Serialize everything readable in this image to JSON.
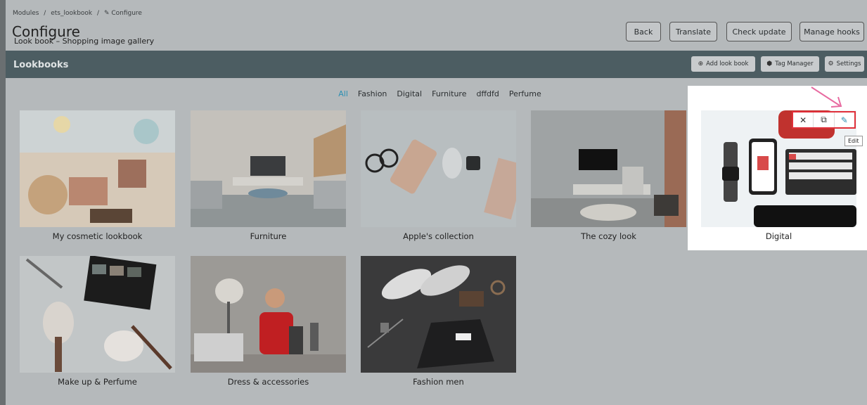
{
  "breadcrumb": [
    "Modules",
    "/",
    "ets_lookbook",
    "/",
    "✎ Configure"
  ],
  "page": {
    "title": "Configure",
    "subtitle": "Look book – Shopping image gallery"
  },
  "toolbar": {
    "back": "Back",
    "translate": "Translate",
    "check_update": "Check update",
    "manage_hooks": "Manage hooks"
  },
  "panel": {
    "title": "Lookbooks",
    "add_label": "Add look book",
    "tag_label": "Tag Manager",
    "settings_label": "Settings"
  },
  "filters": [
    "All",
    "Fashion",
    "Digital",
    "Furniture",
    "dffdfd",
    "Perfume"
  ],
  "lookbooks": [
    "My cosmetic lookbook",
    "Furniture",
    "Apple's collection",
    "The cozy look",
    "Digital",
    "Make up & Perfume",
    "Dress & accessories",
    "Fashion men"
  ],
  "card_actions": {
    "delete": "✕",
    "duplicate": "⧉",
    "edit": "✎",
    "edit_tooltip": "Edit"
  },
  "colors": {
    "accent": "#2b8fb3",
    "highlight_border": "#e0303a",
    "arrow": "#e86aa0",
    "header_bar": "#4c5d62"
  }
}
